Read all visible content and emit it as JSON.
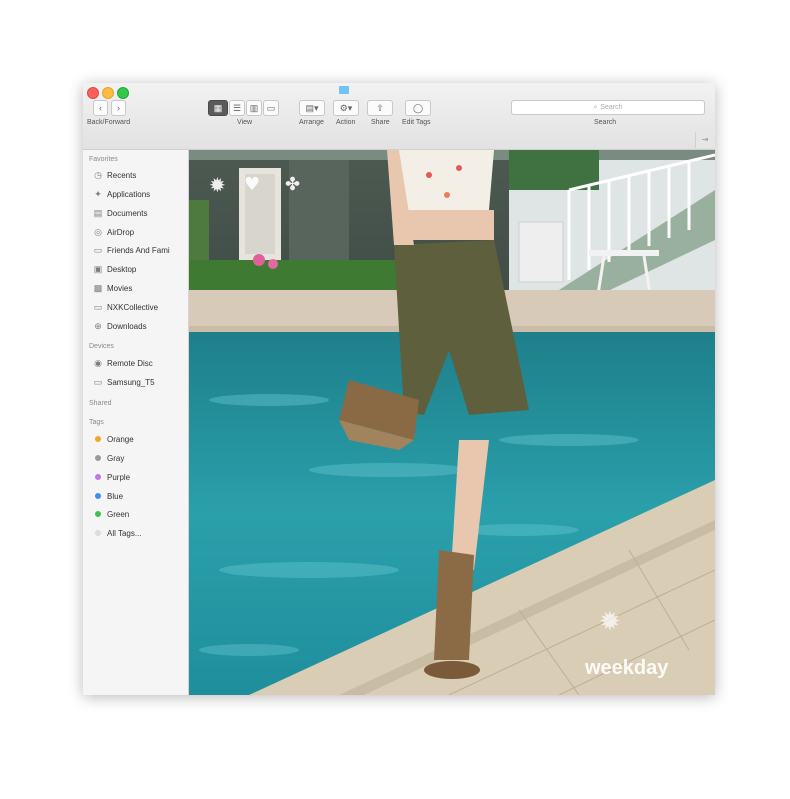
{
  "window": {
    "title": "",
    "toolbar": {
      "back_label": "Back/Forward",
      "view_label": "View",
      "arrange_label": "Arrange",
      "action_label": "Action",
      "share_label": "Share",
      "edit_tags_label": "Edit Tags",
      "search_placeholder": "Search",
      "search_label": "Search"
    }
  },
  "sidebar": {
    "favorites_header": "Favorites",
    "favorites": [
      {
        "label": "Recents",
        "icon": "clock-icon"
      },
      {
        "label": "Applications",
        "icon": "applications-icon"
      },
      {
        "label": "Documents",
        "icon": "documents-icon"
      },
      {
        "label": "AirDrop",
        "icon": "airdrop-icon"
      },
      {
        "label": "Friends And Fami",
        "icon": "folder-icon"
      },
      {
        "label": "Desktop",
        "icon": "desktop-icon"
      },
      {
        "label": "Movies",
        "icon": "movies-icon"
      },
      {
        "label": "NXKCollective",
        "icon": "folder-icon"
      },
      {
        "label": "Downloads",
        "icon": "downloads-icon"
      }
    ],
    "devices_header": "Devices",
    "devices": [
      {
        "label": "Remote Disc",
        "icon": "disc-icon"
      },
      {
        "label": "Samsung_T5",
        "icon": "drive-icon"
      }
    ],
    "shared_header": "Shared",
    "tags_header": "Tags",
    "tags": [
      {
        "label": "Orange",
        "color": "#f5a623"
      },
      {
        "label": "Gray",
        "color": "#9b9b9b"
      },
      {
        "label": "Purple",
        "color": "#c774e8"
      },
      {
        "label": "Blue",
        "color": "#3d8ff5"
      },
      {
        "label": "Green",
        "color": "#3cc451"
      },
      {
        "label": "All Tags...",
        "color": "#dcdcdc"
      }
    ]
  },
  "content": {
    "watermark": "weekday"
  }
}
